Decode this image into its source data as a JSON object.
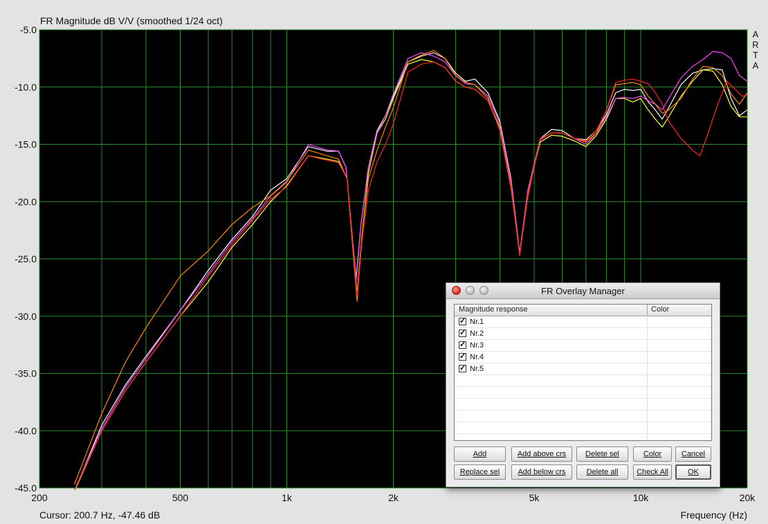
{
  "chart_data": {
    "type": "line",
    "title": "FR Magnitude dB V/V (smoothed 1/24 oct)",
    "xlabel": "Frequency (Hz)",
    "ylabel": "",
    "xscale": "log",
    "xlim": [
      200,
      20000
    ],
    "ylim": [
      -45,
      -5
    ],
    "grid": true,
    "x_ticks": [
      {
        "value": 200,
        "label": "200"
      },
      {
        "value": 500,
        "label": "500"
      },
      {
        "value": 1000,
        "label": "1k"
      },
      {
        "value": 2000,
        "label": "2k"
      },
      {
        "value": 5000,
        "label": "5k"
      },
      {
        "value": 10000,
        "label": "10k"
      },
      {
        "value": 20000,
        "label": "20k"
      }
    ],
    "y_ticks": [
      "-5.0",
      "-10.0",
      "-15.0",
      "-20.0",
      "-25.0",
      "-30.0",
      "-35.0",
      "-40.0",
      "-45.0"
    ],
    "colors": {
      "background": "#000000",
      "grid": "#2e8b2e",
      "plot_border": "#2e8b2e"
    },
    "series": [
      {
        "color": "#ffffff",
        "points": [
          [
            251,
            -45.3
          ],
          [
            300,
            -39.5
          ],
          [
            350,
            -36
          ],
          [
            400,
            -33.5
          ],
          [
            500,
            -29.5
          ],
          [
            600,
            -26
          ],
          [
            700,
            -23.3
          ],
          [
            800,
            -21.3
          ],
          [
            900,
            -19
          ],
          [
            1000,
            -18
          ],
          [
            1150,
            -15.2
          ],
          [
            1300,
            -15.6
          ],
          [
            1400,
            -15.6
          ],
          [
            1470,
            -17
          ],
          [
            1520,
            -22
          ],
          [
            1570,
            -26.7
          ],
          [
            1620,
            -22
          ],
          [
            1700,
            -17
          ],
          [
            1800,
            -13.8
          ],
          [
            1900,
            -12.5
          ],
          [
            2000,
            -10.8
          ],
          [
            2200,
            -7.8
          ],
          [
            2400,
            -7.3
          ],
          [
            2600,
            -7
          ],
          [
            2800,
            -7.5
          ],
          [
            3000,
            -8.8
          ],
          [
            3200,
            -9.5
          ],
          [
            3400,
            -9.3
          ],
          [
            3700,
            -10.5
          ],
          [
            4000,
            -13
          ],
          [
            4300,
            -18
          ],
          [
            4550,
            -24.5
          ],
          [
            4800,
            -19
          ],
          [
            5200,
            -14.5
          ],
          [
            5600,
            -13.7
          ],
          [
            6000,
            -13.8
          ],
          [
            6500,
            -14.5
          ],
          [
            7000,
            -14.6
          ],
          [
            7500,
            -13.8
          ],
          [
            8000,
            -12.4
          ],
          [
            8500,
            -10.5
          ],
          [
            9000,
            -10.2
          ],
          [
            9500,
            -10.3
          ],
          [
            10000,
            -10.2
          ],
          [
            10500,
            -11.3
          ],
          [
            11000,
            -12
          ],
          [
            11500,
            -12.8
          ],
          [
            12000,
            -11.8
          ],
          [
            13000,
            -9.8
          ],
          [
            14000,
            -8.8
          ],
          [
            15000,
            -8.5
          ],
          [
            16000,
            -8.4
          ],
          [
            17000,
            -8.5
          ],
          [
            18000,
            -11
          ],
          [
            19000,
            -12.5
          ],
          [
            20000,
            -12
          ]
        ]
      },
      {
        "color": "#ffff33",
        "points": [
          [
            251,
            -45.3
          ],
          [
            300,
            -40
          ],
          [
            350,
            -36.5
          ],
          [
            400,
            -34
          ],
          [
            500,
            -30
          ],
          [
            600,
            -27
          ],
          [
            700,
            -24
          ],
          [
            800,
            -22
          ],
          [
            900,
            -20
          ],
          [
            1000,
            -18.6
          ],
          [
            1150,
            -16
          ],
          [
            1300,
            -16.3
          ],
          [
            1400,
            -16.5
          ],
          [
            1480,
            -18
          ],
          [
            1530,
            -23
          ],
          [
            1580,
            -28
          ],
          [
            1630,
            -23
          ],
          [
            1700,
            -17.5
          ],
          [
            1800,
            -14
          ],
          [
            1900,
            -12.8
          ],
          [
            2000,
            -11
          ],
          [
            2200,
            -8
          ],
          [
            2400,
            -7.6
          ],
          [
            2600,
            -7.8
          ],
          [
            2800,
            -8.3
          ],
          [
            3000,
            -9.5
          ],
          [
            3200,
            -10
          ],
          [
            3400,
            -10.2
          ],
          [
            3700,
            -11.2
          ],
          [
            4000,
            -13.5
          ],
          [
            4300,
            -18.3
          ],
          [
            4550,
            -24.7
          ],
          [
            4800,
            -19
          ],
          [
            5200,
            -14.8
          ],
          [
            5600,
            -14.2
          ],
          [
            6000,
            -14.3
          ],
          [
            6500,
            -14.7
          ],
          [
            7000,
            -15.2
          ],
          [
            7500,
            -14.2
          ],
          [
            8000,
            -12.8
          ],
          [
            8500,
            -11
          ],
          [
            9000,
            -11
          ],
          [
            9500,
            -11.3
          ],
          [
            10000,
            -11
          ],
          [
            10500,
            -12
          ],
          [
            11000,
            -12.8
          ],
          [
            11500,
            -13.5
          ],
          [
            12000,
            -12.6
          ],
          [
            13000,
            -10.8
          ],
          [
            14000,
            -9.5
          ],
          [
            15000,
            -8.5
          ],
          [
            16000,
            -8.6
          ],
          [
            17000,
            -9.8
          ],
          [
            18000,
            -11.7
          ],
          [
            19000,
            -12.6
          ],
          [
            20000,
            -12.6
          ]
        ]
      },
      {
        "color": "#ff44ff",
        "points": [
          [
            251,
            -45.2
          ],
          [
            300,
            -39.8
          ],
          [
            350,
            -36.2
          ],
          [
            400,
            -33.7
          ],
          [
            500,
            -29.5
          ],
          [
            600,
            -26.3
          ],
          [
            700,
            -23.5
          ],
          [
            800,
            -21.5
          ],
          [
            900,
            -19.5
          ],
          [
            1000,
            -18.3
          ],
          [
            1150,
            -15
          ],
          [
            1300,
            -15.5
          ],
          [
            1400,
            -15.6
          ],
          [
            1470,
            -17
          ],
          [
            1520,
            -22
          ],
          [
            1570,
            -27
          ],
          [
            1620,
            -22
          ],
          [
            1700,
            -17
          ],
          [
            1800,
            -14
          ],
          [
            1900,
            -12.5
          ],
          [
            2000,
            -10.6
          ],
          [
            2200,
            -7.5
          ],
          [
            2400,
            -7
          ],
          [
            2600,
            -7.3
          ],
          [
            2800,
            -7.8
          ],
          [
            3000,
            -9
          ],
          [
            3200,
            -9.7
          ],
          [
            3400,
            -9.8
          ],
          [
            3700,
            -10.8
          ],
          [
            4000,
            -13.2
          ],
          [
            4300,
            -18.2
          ],
          [
            4550,
            -24.6
          ],
          [
            4800,
            -19
          ],
          [
            5200,
            -14.6
          ],
          [
            5600,
            -14
          ],
          [
            6000,
            -14
          ],
          [
            6500,
            -14.5
          ],
          [
            7000,
            -15
          ],
          [
            7500,
            -14
          ],
          [
            8000,
            -12.6
          ],
          [
            8500,
            -11
          ],
          [
            9000,
            -10.9
          ],
          [
            9500,
            -11
          ],
          [
            10000,
            -10.8
          ],
          [
            10500,
            -11.2
          ],
          [
            11000,
            -11.5
          ],
          [
            11500,
            -12
          ],
          [
            12000,
            -11
          ],
          [
            13000,
            -9.2
          ],
          [
            14000,
            -8.2
          ],
          [
            15000,
            -7.6
          ],
          [
            16000,
            -6.9
          ],
          [
            17000,
            -7
          ],
          [
            18000,
            -7.5
          ],
          [
            19000,
            -9
          ],
          [
            20000,
            -9.5
          ]
        ]
      },
      {
        "color": "#ff8800",
        "points": [
          [
            251,
            -44.7
          ],
          [
            300,
            -38.5
          ],
          [
            350,
            -34
          ],
          [
            400,
            -31
          ],
          [
            500,
            -26.5
          ],
          [
            600,
            -24.3
          ],
          [
            700,
            -22
          ],
          [
            800,
            -20.5
          ],
          [
            900,
            -19.5
          ],
          [
            1000,
            -18.2
          ],
          [
            1150,
            -15.5
          ],
          [
            1300,
            -16
          ],
          [
            1400,
            -16.3
          ],
          [
            1480,
            -18
          ],
          [
            1530,
            -23.5
          ],
          [
            1580,
            -28.7
          ],
          [
            1630,
            -23
          ],
          [
            1700,
            -18
          ],
          [
            1800,
            -15.5
          ],
          [
            1900,
            -13.5
          ],
          [
            2000,
            -11.8
          ],
          [
            2200,
            -7.8
          ],
          [
            2400,
            -7.2
          ],
          [
            2600,
            -6.8
          ],
          [
            2800,
            -7.5
          ],
          [
            3000,
            -9
          ],
          [
            3200,
            -9.6
          ],
          [
            3400,
            -9.8
          ],
          [
            3700,
            -11
          ],
          [
            4000,
            -13.8
          ],
          [
            4300,
            -18.8
          ],
          [
            4550,
            -24.6
          ],
          [
            4800,
            -19.5
          ],
          [
            5200,
            -14.5
          ],
          [
            5600,
            -14
          ],
          [
            6000,
            -14
          ],
          [
            6500,
            -14.5
          ],
          [
            7000,
            -14.8
          ],
          [
            7500,
            -14
          ],
          [
            8000,
            -12
          ],
          [
            8500,
            -9.8
          ],
          [
            9000,
            -9.7
          ],
          [
            9500,
            -9.6
          ],
          [
            10000,
            -9.8
          ],
          [
            10500,
            -10.8
          ],
          [
            11000,
            -11.5
          ],
          [
            11500,
            -12.3
          ],
          [
            12000,
            -12
          ],
          [
            13000,
            -11
          ],
          [
            14000,
            -9.3
          ],
          [
            15000,
            -8.2
          ],
          [
            16000,
            -8.3
          ],
          [
            17000,
            -9
          ],
          [
            18000,
            -10.6
          ],
          [
            19000,
            -11.5
          ],
          [
            20000,
            -10.5
          ]
        ]
      },
      {
        "color": "#ff2222",
        "points": [
          [
            251,
            -45.2
          ],
          [
            300,
            -40
          ],
          [
            350,
            -36.5
          ],
          [
            400,
            -34
          ],
          [
            500,
            -30
          ],
          [
            600,
            -26.5
          ],
          [
            700,
            -23.8
          ],
          [
            800,
            -21.6
          ],
          [
            900,
            -19.8
          ],
          [
            1000,
            -18.7
          ],
          [
            1150,
            -16
          ],
          [
            1300,
            -16.4
          ],
          [
            1400,
            -16.6
          ],
          [
            1480,
            -18
          ],
          [
            1530,
            -23.2
          ],
          [
            1580,
            -28.2
          ],
          [
            1630,
            -23.5
          ],
          [
            1700,
            -19
          ],
          [
            1800,
            -16.5
          ],
          [
            1900,
            -15
          ],
          [
            2000,
            -13.2
          ],
          [
            2200,
            -8.7
          ],
          [
            2400,
            -8
          ],
          [
            2600,
            -7.8
          ],
          [
            2800,
            -8.3
          ],
          [
            3000,
            -9.5
          ],
          [
            3200,
            -10
          ],
          [
            3400,
            -10.2
          ],
          [
            3700,
            -11.2
          ],
          [
            4000,
            -13.7
          ],
          [
            4300,
            -18.6
          ],
          [
            4550,
            -24.7
          ],
          [
            4800,
            -19.3
          ],
          [
            5200,
            -14.5
          ],
          [
            5600,
            -14
          ],
          [
            6000,
            -14
          ],
          [
            6500,
            -14.5
          ],
          [
            7000,
            -14.7
          ],
          [
            7500,
            -13.8
          ],
          [
            8000,
            -12
          ],
          [
            8500,
            -9.6
          ],
          [
            9000,
            -9.4
          ],
          [
            9500,
            -9.3
          ],
          [
            10000,
            -9.5
          ],
          [
            10500,
            -9.7
          ],
          [
            11000,
            -10.5
          ],
          [
            11500,
            -11.5
          ],
          [
            12000,
            -13
          ],
          [
            13000,
            -14.5
          ],
          [
            14000,
            -15.5
          ],
          [
            14700,
            -16
          ],
          [
            15500,
            -14
          ],
          [
            16500,
            -11.5
          ],
          [
            17500,
            -9.5
          ],
          [
            18500,
            -10.2
          ],
          [
            19300,
            -10.8
          ],
          [
            20000,
            -10.7
          ]
        ]
      }
    ]
  },
  "side_label": [
    "A",
    "R",
    "T",
    "A"
  ],
  "cursor_readout": "Cursor: 200.7 Hz, -47.46 dB",
  "dialog": {
    "title": "FR Overlay Manager",
    "columns": [
      "Magnitude response",
      "Color"
    ],
    "rows": [
      {
        "label": "Nr.1",
        "checked": true
      },
      {
        "label": "Nr.2",
        "checked": true
      },
      {
        "label": "Nr.3",
        "checked": true
      },
      {
        "label": "Nr.4",
        "checked": true
      },
      {
        "label": "Nr.5",
        "checked": true
      }
    ],
    "check_mark": "✓",
    "buttons": {
      "add": "Add",
      "add_above": "Add above crs",
      "delete_sel": "Delete sel",
      "color": "Color",
      "cancel": "Cancel",
      "replace_sel": "Replace sel",
      "add_below": "Add below crs",
      "delete_all": "Delete all",
      "check_all": "Check All",
      "ok": "OK"
    }
  }
}
